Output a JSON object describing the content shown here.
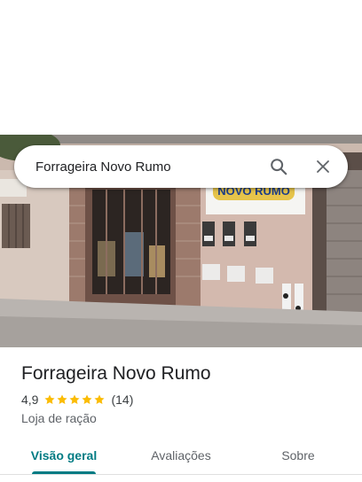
{
  "search": {
    "query": "Forrageira Novo Rumo"
  },
  "photo": {
    "sign_text": "NOVO RUMO"
  },
  "place": {
    "name": "Forrageira Novo Rumo",
    "rating": "4,9",
    "stars": 5,
    "review_count": "(14)",
    "category": "Loja de ração"
  },
  "tabs": [
    {
      "label": "Visão geral",
      "active": true
    },
    {
      "label": "Avaliações",
      "active": false
    },
    {
      "label": "Sobre",
      "active": false
    }
  ],
  "colors": {
    "accent": "#007b83",
    "star": "#fbbc04"
  }
}
